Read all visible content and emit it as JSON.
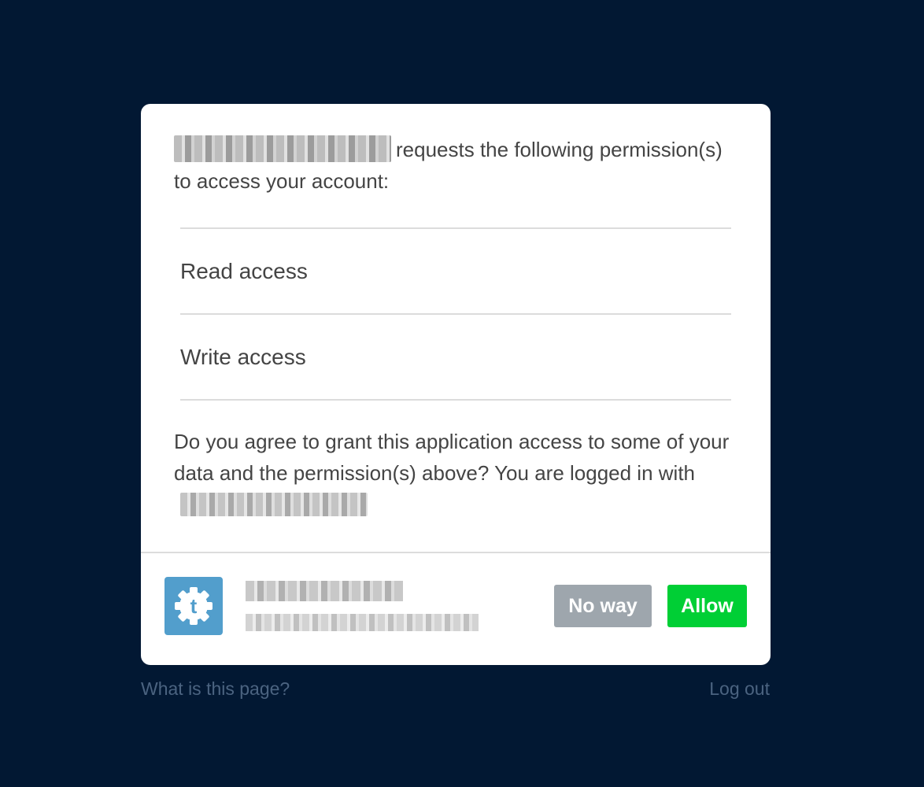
{
  "card": {
    "request_text": "requests the following permission(s) to access your account:",
    "permissions": [
      {
        "label": "Read access"
      },
      {
        "label": "Write access"
      }
    ],
    "agree_text": "Do you agree to grant this application access to some of your data and the permission(s) above? You are logged in with",
    "app_icon": {
      "name": "tumblr-gear-icon",
      "color": "#529ecc",
      "glyph": "t"
    },
    "buttons": {
      "deny_label": "No way",
      "allow_label": "Allow",
      "deny_color": "#9ea6ad",
      "allow_color": "#00cf35"
    }
  },
  "links": {
    "what_label": "What is this page?",
    "logout_label": "Log out"
  },
  "colors": {
    "background": "#021833",
    "card": "#ffffff",
    "text": "#444444",
    "link": "#4b6380"
  }
}
